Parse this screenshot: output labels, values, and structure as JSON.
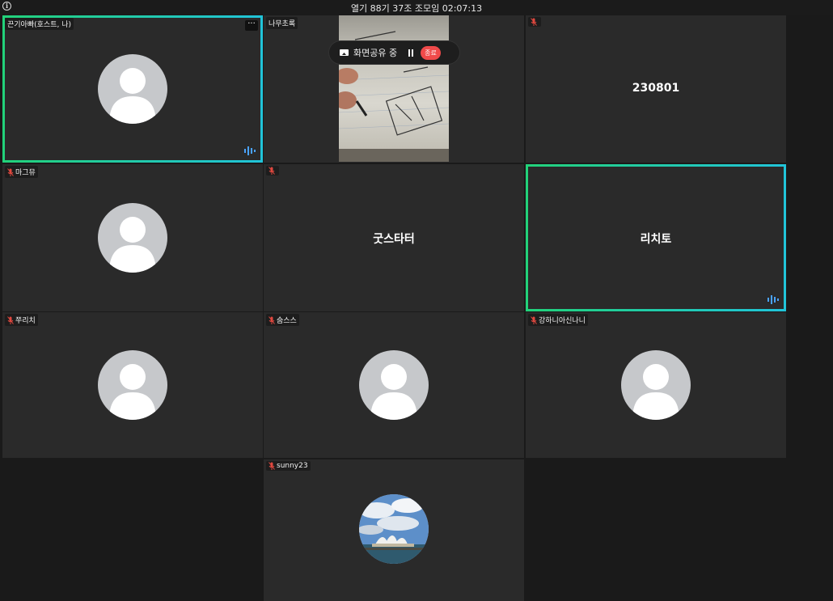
{
  "header": {
    "title": "열기 88기 37조 조모임 02:07:13"
  },
  "share_bar": {
    "label": "화면공유 중",
    "end_label": "종료"
  },
  "tiles": [
    {
      "name": "끈기아빠(호스트, 나)",
      "muted": false,
      "speaking": true
    },
    {
      "name": "나무초록",
      "muted": false,
      "video": true
    },
    {
      "name": "",
      "muted": true,
      "display_name": "230801"
    },
    {
      "name": "마그뮤",
      "muted": true
    },
    {
      "name": "",
      "muted": true,
      "display_name": "굿스타터"
    },
    {
      "name": "",
      "muted": false,
      "display_name": "리치토",
      "speaking": true
    },
    {
      "name": "쭈리치",
      "muted": true
    },
    {
      "name": "숨스스",
      "muted": true
    },
    {
      "name": "강하니아신나니",
      "muted": true
    },
    {
      "name": "sunny23",
      "muted": true,
      "photo": true
    }
  ],
  "colors": {
    "active_border_start": "#22d27a",
    "active_border_end": "#21c4d9",
    "mic_off": "#e0483f",
    "end_button": "#f04a4a",
    "talk_indicator": "#4aa3ff"
  }
}
